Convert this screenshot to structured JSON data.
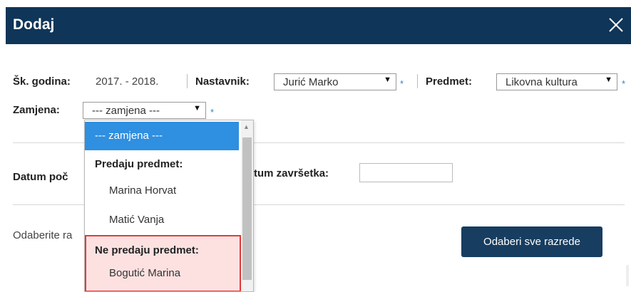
{
  "dialog": {
    "title": "Dodaj",
    "close_label": "Close"
  },
  "filters": {
    "school_year_label": "Šk. godina:",
    "school_year_value": "2017. - 2018.",
    "teacher_label": "Nastavnik:",
    "teacher_value": "Jurić Marko",
    "subject_label": "Predmet:",
    "subject_value": "Likovna kultura",
    "substitute_label": "Zamjena:",
    "substitute_value": "--- zamjena ---",
    "required_mark": "*"
  },
  "dates": {
    "start_label_partial": "Datum poč",
    "end_label_partial": "tum završetka:"
  },
  "classes": {
    "prompt_partial": "Odaberite ra",
    "select_all_button": "Odaberi sve razrede"
  },
  "dropdown": {
    "selected": "--- zamjena ---",
    "group_teaching": "Predaju predmet:",
    "teaching": [
      "Marina Horvat",
      "Matić Vanja"
    ],
    "group_not_teaching": "Ne predaju predmet:",
    "not_teaching": [
      "Bogutić Marina"
    ]
  },
  "colors": {
    "header_bg": "#0f3558",
    "accent": "#2f8fe0",
    "required": "#2b87c9",
    "highlight_border": "#e03a3a",
    "highlight_bg": "#fde1e1",
    "button_bg": "#173d60"
  }
}
